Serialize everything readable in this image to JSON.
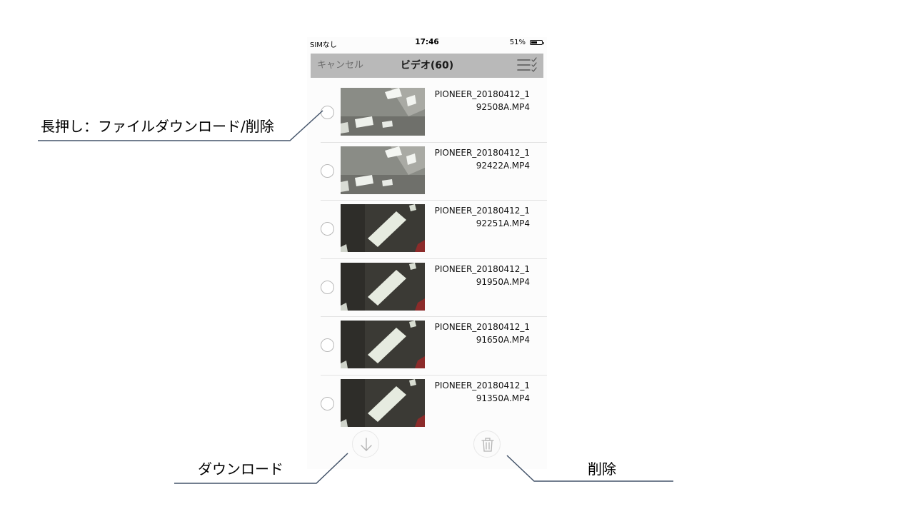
{
  "status_bar": {
    "carrier": "SIMなし",
    "time": "17:46",
    "battery_percent": "51%"
  },
  "nav": {
    "cancel_label": "キャンセル",
    "title": "ビデオ(60)",
    "select_all_icon": "checklist-icon"
  },
  "files": [
    {
      "name_line1": "PIONEER_20180412_1",
      "name_line2": "92508A.MP4",
      "thumb_style": "bright"
    },
    {
      "name_line1": "PIONEER_20180412_1",
      "name_line2": "92422A.MP4",
      "thumb_style": "bright"
    },
    {
      "name_line1": "PIONEER_20180412_1",
      "name_line2": "92251A.MP4",
      "thumb_style": "dark"
    },
    {
      "name_line1": "PIONEER_20180412_1",
      "name_line2": "91950A.MP4",
      "thumb_style": "dark"
    },
    {
      "name_line1": "PIONEER_20180412_1",
      "name_line2": "91650A.MP4",
      "thumb_style": "dark"
    },
    {
      "name_line1": "PIONEER_20180412_1",
      "name_line2": "91350A.MP4",
      "thumb_style": "dark"
    }
  ],
  "toolbar": {
    "download_icon": "download-arrow-icon",
    "delete_icon": "trash-icon"
  },
  "annotations": {
    "long_press": "長押し：ファイルダウンロード/削除",
    "download": "ダウンロード",
    "delete": "削除"
  },
  "colors": {
    "nav_background": "#b9b9b9",
    "leader_line": "#44546a"
  }
}
